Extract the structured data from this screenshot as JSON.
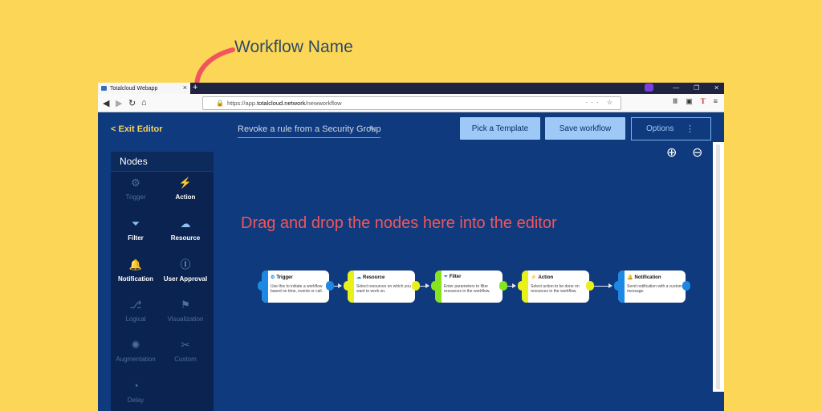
{
  "annotations": {
    "workflow_name_label": "Workflow Name",
    "drop_hint": "Drag and drop the nodes here into the editor"
  },
  "browser": {
    "tab_title": "Totalcloud Webapp",
    "tab_close": "×",
    "new_tab": "+",
    "url_prefix": "https://app.",
    "url_domain": "totalcloud.network",
    "url_path": "/newworkflow",
    "window_controls": [
      "—",
      "❐",
      "✕"
    ]
  },
  "editor": {
    "exit_label": "< Exit Editor",
    "workflow_name_value": "Revoke a rule from a Security Group",
    "pick_template_label": "Pick a Template",
    "save_workflow_label": "Save workflow",
    "options_label": "Options",
    "options_menu_icon": "⋮"
  },
  "nodes_panel": {
    "title": "Nodes",
    "items": [
      {
        "label": "Trigger",
        "icon": "trigger-icon",
        "glyph": "⚙",
        "enabled": false
      },
      {
        "label": "Action",
        "icon": "lightning-icon",
        "glyph": "⚡",
        "enabled": true
      },
      {
        "label": "Filter",
        "icon": "filter-icon",
        "glyph": "⏷",
        "enabled": true
      },
      {
        "label": "Resource",
        "icon": "resource-icon",
        "glyph": "☁",
        "enabled": true
      },
      {
        "label": "Notification",
        "icon": "bell-icon",
        "glyph": "🔔",
        "enabled": true
      },
      {
        "label": "User Approval",
        "icon": "user-approval-icon",
        "glyph": "Ⓘ",
        "enabled": true
      },
      {
        "label": "Logical",
        "icon": "logical-icon",
        "glyph": "⎇",
        "enabled": false
      },
      {
        "label": "Visualization",
        "icon": "visualization-icon",
        "glyph": "⚑",
        "enabled": false
      },
      {
        "label": "Augmentation",
        "icon": "augmentation-icon",
        "glyph": "✺",
        "enabled": false
      },
      {
        "label": "Custom",
        "icon": "custom-icon",
        "glyph": "✂",
        "enabled": false
      },
      {
        "label": "Delay",
        "icon": "clock-icon",
        "glyph": "◔",
        "enabled": false
      }
    ]
  },
  "flow": {
    "nodes": [
      {
        "title": "Trigger",
        "desc": "Use this to initiate a workflow based on time, events or call.",
        "color": "#1e88e5",
        "icon": "trigger-icon",
        "glyph": "⚙"
      },
      {
        "title": "Resource",
        "desc": "Select resources on which you want to work on.",
        "color": "#e8f21a",
        "icon": "resource-icon",
        "glyph": "☁"
      },
      {
        "title": "Filter",
        "desc": "Enter parameters to filter resources in the workflow.",
        "color": "#86e31e",
        "icon": "filter-icon",
        "glyph": "⏷"
      },
      {
        "title": "Action",
        "desc": "Select action to be done on resources in the workflow.",
        "color": "#e8f21a",
        "icon": "lightning-icon",
        "glyph": "⚡"
      },
      {
        "title": "Notification",
        "desc": "Send notification with a custom message.",
        "color": "#1e88e5",
        "icon": "bell-icon",
        "glyph": "🔔"
      }
    ]
  },
  "colors": {
    "background": "#fcd757",
    "canvas": "#0f3a7d",
    "accent_button": "#9ec9f7",
    "exit_link": "#f6d35c",
    "annotation_red": "#f0555d"
  }
}
